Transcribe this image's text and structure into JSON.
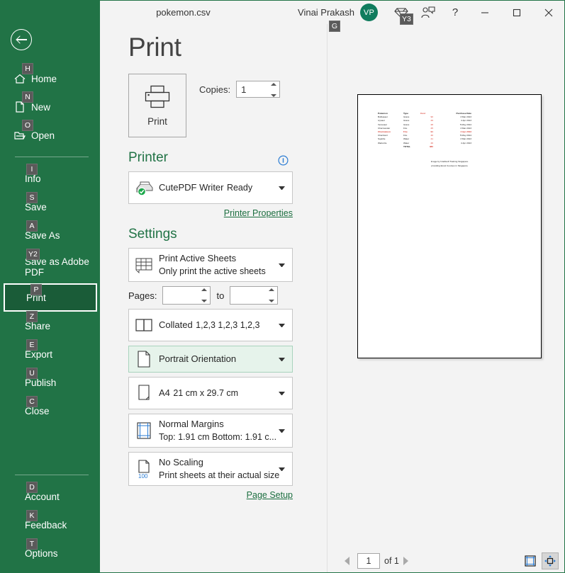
{
  "titlebar": {
    "document_title": "pokemon.csv",
    "user_name": "Vinai Prakash",
    "user_keytip": "G",
    "avatar_initials": "VP",
    "premium_keytip": "Y3",
    "premium_icon": "diamond-icon",
    "feedback_icon": "feedback-person-icon",
    "help_label": "?",
    "minimize_label": "—",
    "maximize_label": "□",
    "close_label": "✕"
  },
  "sidebar": {
    "back_icon": "back-arrow-icon",
    "top_items": [
      {
        "label": "Home",
        "keytip": "H",
        "icon": "home-icon",
        "selected": false
      },
      {
        "label": "New",
        "keytip": "N",
        "icon": "new-doc-icon",
        "selected": false
      },
      {
        "label": "Open",
        "keytip": "O",
        "icon": "folder-open-icon",
        "selected": false
      }
    ],
    "mid_items": [
      {
        "label": "Info",
        "keytip": "I",
        "selected": false
      },
      {
        "label": "Save",
        "keytip": "S",
        "selected": false
      },
      {
        "label": "Save As",
        "keytip": "A",
        "selected": false
      },
      {
        "label": "Save as Adobe PDF",
        "line1": "Save as Adobe",
        "line2": "PDF",
        "keytip": "Y2",
        "selected": false
      },
      {
        "label": "Print",
        "keytip": "P",
        "selected": true
      },
      {
        "label": "Share",
        "keytip": "Z",
        "selected": false
      },
      {
        "label": "Export",
        "keytip": "E",
        "selected": false
      },
      {
        "label": "Publish",
        "keytip": "U",
        "selected": false
      },
      {
        "label": "Close",
        "keytip": "C",
        "selected": false
      }
    ],
    "bottom_items": [
      {
        "label": "Account",
        "keytip": "D"
      },
      {
        "label": "Feedback",
        "keytip": "K"
      },
      {
        "label": "Options",
        "keytip": "T"
      }
    ]
  },
  "main": {
    "page_title": "Print",
    "print_button_label": "Print",
    "copies_label": "Copies:",
    "copies_value": "1",
    "printer_section_title": "Printer",
    "printer_info_icon": "info-circle-icon",
    "printer_name": "CutePDF Writer",
    "printer_status": "Ready",
    "printer_properties_link": "Printer Properties",
    "settings_section_title": "Settings",
    "pages_label": "Pages:",
    "pages_from_value": "",
    "pages_from_placeholder": "",
    "pages_to_label": "to",
    "pages_to_value": "",
    "pages_to_placeholder": "",
    "page_setup_link": "Page Setup",
    "settings": [
      {
        "name": "print-area",
        "title": "Print Active Sheets",
        "subtitle": "Only print the active sheets",
        "icon": "grid-sheet-icon",
        "hovered": false
      },
      {
        "name": "collation",
        "title": "Collated",
        "subtitle": "1,2,3   1,2,3   1,2,3",
        "icon": "collate-icon",
        "hovered": false
      },
      {
        "name": "orientation",
        "title": "Portrait Orientation",
        "subtitle": "",
        "icon": "portrait-page-icon",
        "hovered": true
      },
      {
        "name": "paper-size",
        "title": "A4",
        "subtitle": "21 cm x 29.7 cm",
        "icon": "paper-icon",
        "hovered": false
      },
      {
        "name": "margins",
        "title": "Normal Margins",
        "subtitle": "Top: 1.91 cm Bottom: 1.91 c...",
        "icon": "margins-icon",
        "hovered": false
      },
      {
        "name": "scaling",
        "title": "No Scaling",
        "subtitle": "Print sheets at their actual size",
        "icon": "scaling-100-icon",
        "hovered": false
      }
    ]
  },
  "preview": {
    "table_headers": [
      "Pokemon",
      "Type",
      "Cost",
      "Purchase Date"
    ],
    "rows": [
      {
        "name": "Bulbasaur",
        "type": "Grass",
        "cost": "90",
        "date": "3 Mar 2013",
        "highlight": false
      },
      {
        "name": "Ivysaur",
        "type": "Grass",
        "cost": "29",
        "date": "4 Apr 2013",
        "highlight": false
      },
      {
        "name": "Venusaur",
        "type": "Grass",
        "cost": "28",
        "date": "5 May 2014",
        "highlight": false
      },
      {
        "name": "Charmander",
        "type": "Fire",
        "cost": "25",
        "date": "3 Mar 2013",
        "highlight": false
      },
      {
        "name": "Charmeleon",
        "type": "Fire",
        "cost": "91",
        "date": "4 Apr 2013",
        "highlight": true
      },
      {
        "name": "Charizard",
        "type": "Fire",
        "cost": "40",
        "date": "5 May 2014",
        "highlight": false
      },
      {
        "name": "Squirtle",
        "type": "Water",
        "cost": "41",
        "date": "3 Mar 2013",
        "highlight": false
      },
      {
        "name": "Wartortle",
        "type": "Water",
        "cost": "26",
        "date": "4 Apr 2013",
        "highlight": false
      }
    ],
    "total_label": "TOTAL",
    "total_value": "380",
    "footer_line1": "Image by Intellisoft Training Singapore",
    "footer_line2": "providing Excel Courses in Singapore",
    "page_current": "1",
    "page_of_label": "of 1",
    "prev_icon": "previous-page-arrow-icon",
    "next_icon": "next-page-arrow-icon",
    "show_margins_icon": "show-margins-icon",
    "zoom_to_page_icon": "zoom-to-page-icon"
  },
  "colors": {
    "brand_green": "#217346",
    "accent_link": "#1b6e3f",
    "cost_red": "#d83b2f"
  }
}
